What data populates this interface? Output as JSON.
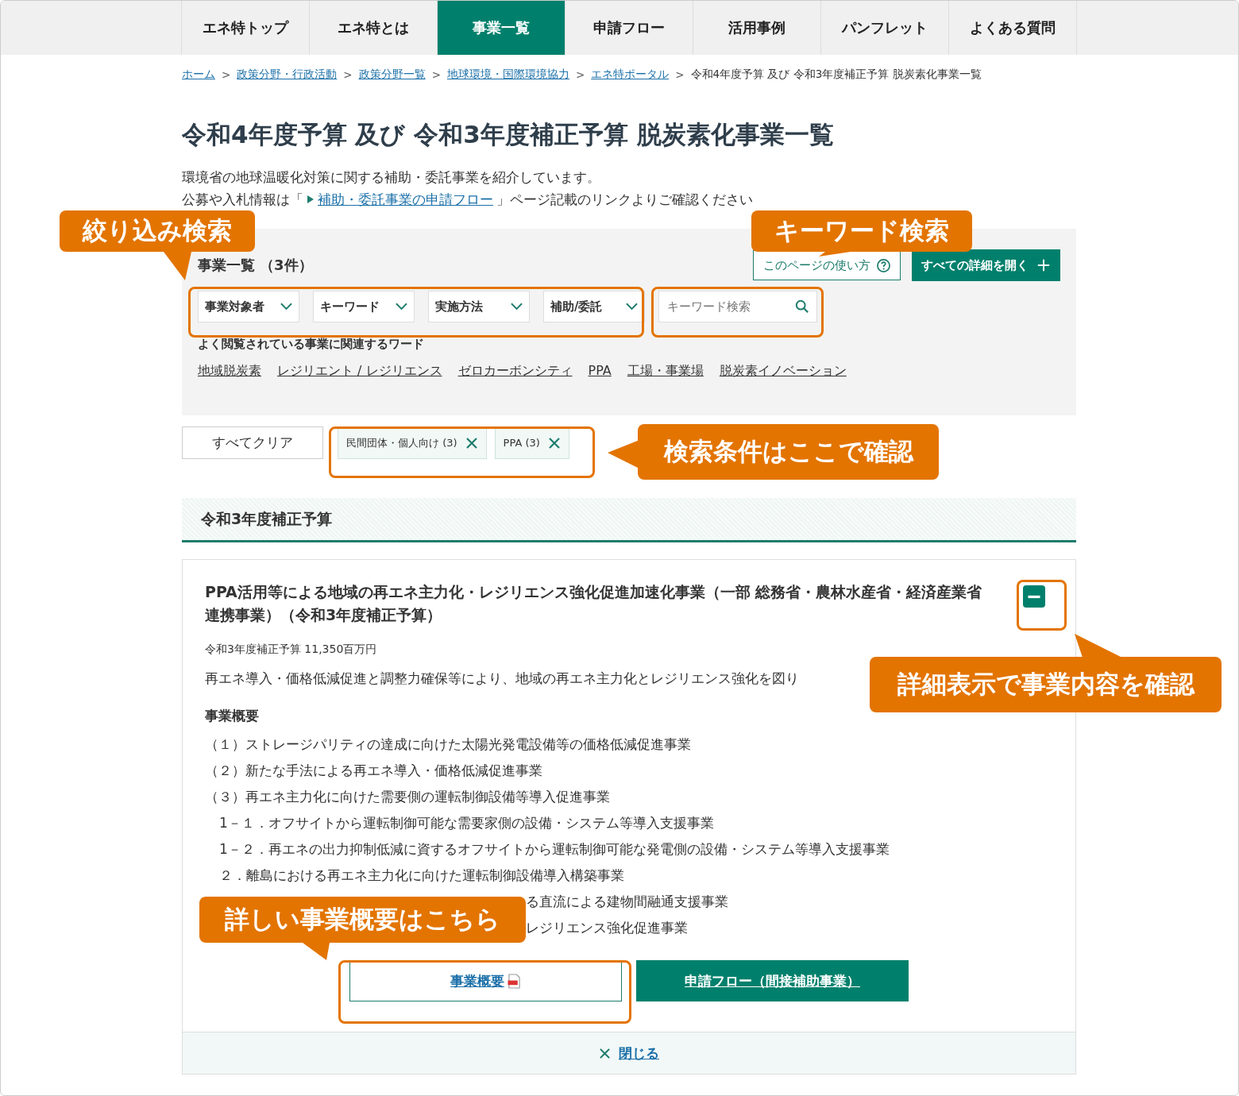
{
  "nav": [
    {
      "label": "エネ特トップ",
      "selected": false
    },
    {
      "label": "エネ特とは",
      "selected": false
    },
    {
      "label": "事業一覧",
      "selected": true
    },
    {
      "label": "申請フロー",
      "selected": false
    },
    {
      "label": "活用事例",
      "selected": false
    },
    {
      "label": "パンフレット",
      "selected": false
    },
    {
      "label": "よくある質問",
      "selected": false
    }
  ],
  "breadcrumb": [
    {
      "label": "ホーム",
      "kind": "link"
    },
    {
      "label": "政策分野・行政活動",
      "kind": "link",
      "separator": ">"
    },
    {
      "label": "政策分野一覧",
      "kind": "link",
      "separator": ">"
    },
    {
      "label": "地球環境・国際環境協力",
      "kind": "link",
      "separator": ">"
    },
    {
      "label": "エネ特ポータル",
      "kind": "link",
      "separator": ">"
    },
    {
      "label": "令和4年度予算 及び 令和3年度補正予算 脱炭素化事業一覧",
      "kind": "current",
      "separator": ">"
    }
  ],
  "title": "令和4年度予算 及び 令和3年度補正予算 脱炭素化事業一覧",
  "intro": {
    "line": "環境省の地球温暖化対策に関する補助・委託事業を紹介しています。",
    "prefix": "公募や入札情報は「",
    "link": "補助・委託事業の申請フロー",
    "suffix": "」ページ記載のリンクよりご確認ください"
  },
  "panel": {
    "heading": "事業一覧",
    "count": "（3件）",
    "help_button": "このページの使い方",
    "expand_all": "すべての詳細を開く",
    "filters": [
      "事業対象者",
      "キーワード",
      "実施方法",
      "補助/委託"
    ],
    "keyword_placeholder": "キーワード検索",
    "popular_heading": "よく閲覧されている事業に関連するワード",
    "popular_words": [
      "地域脱炭素",
      "レジリエント / レジリエンス",
      "ゼロカーボンシティ",
      "PPA",
      "工場・事業場",
      "脱炭素イノベーション"
    ]
  },
  "conditions": {
    "clear": "すべてクリア",
    "chips": [
      "民間団体・個人向け (3)",
      "PPA (3)"
    ]
  },
  "section_heading": "令和3年度補正予算",
  "project": {
    "title": "PPA活用等による地域の再エネ主力化・レジリエンス強化促進加速化事業（一部 総務省・農林水産省・経済産業省連携事業）（令和3年度補正予算）",
    "expanded": true,
    "budget": "令和3年度補正予算 11,350百万円",
    "summary": "再エネ導入・価格低減促進と調整力確保等により、地域の再エネ主力化とレジリエンス強化を図り",
    "outline_heading": "事業概要",
    "outline": [
      {
        "text": "（１）ストレージパリティの達成に向けた太陽光発電設備等の価格低減促進事業",
        "kind": "full"
      },
      {
        "text": "（２）新たな手法による再エネ導入・価格低減促進事業",
        "kind": "full"
      },
      {
        "text": "（３）再エネ主力化に向けた需要側の運転制御設備等導入促進事業",
        "kind": "full",
        "children": [
          {
            "text": "1－１．オフサイトから運転制御可能な需要家側の設備・システム等導入支援事業",
            "kind": "full"
          },
          {
            "text": "1－２．再エネの出力抑制低減に資するオフサイトから運転制御可能な発電側の設備・システム等導入支援事業",
            "kind": "full"
          },
          {
            "text": "２．離島における再エネ主力化に向けた運転制御設備導入構築事業",
            "kind": "full"
          },
          {
            "text": "る直流による建物間融通支援事業",
            "kind": "partial"
          }
        ]
      },
      {
        "text": "レジリエンス強化促進事業",
        "kind": "partial"
      }
    ],
    "buttons": [
      {
        "label": "事業概要",
        "kind": "outline"
      },
      {
        "label": "申請フロー（間接補助事業）",
        "kind": "filled"
      }
    ],
    "close": "閉じる"
  },
  "callouts": [
    "絞り込み検索",
    "キーワード検索",
    "検索条件はここで確認",
    "詳細表示で事業内容を確認",
    "詳しい事業概要はこちら"
  ]
}
